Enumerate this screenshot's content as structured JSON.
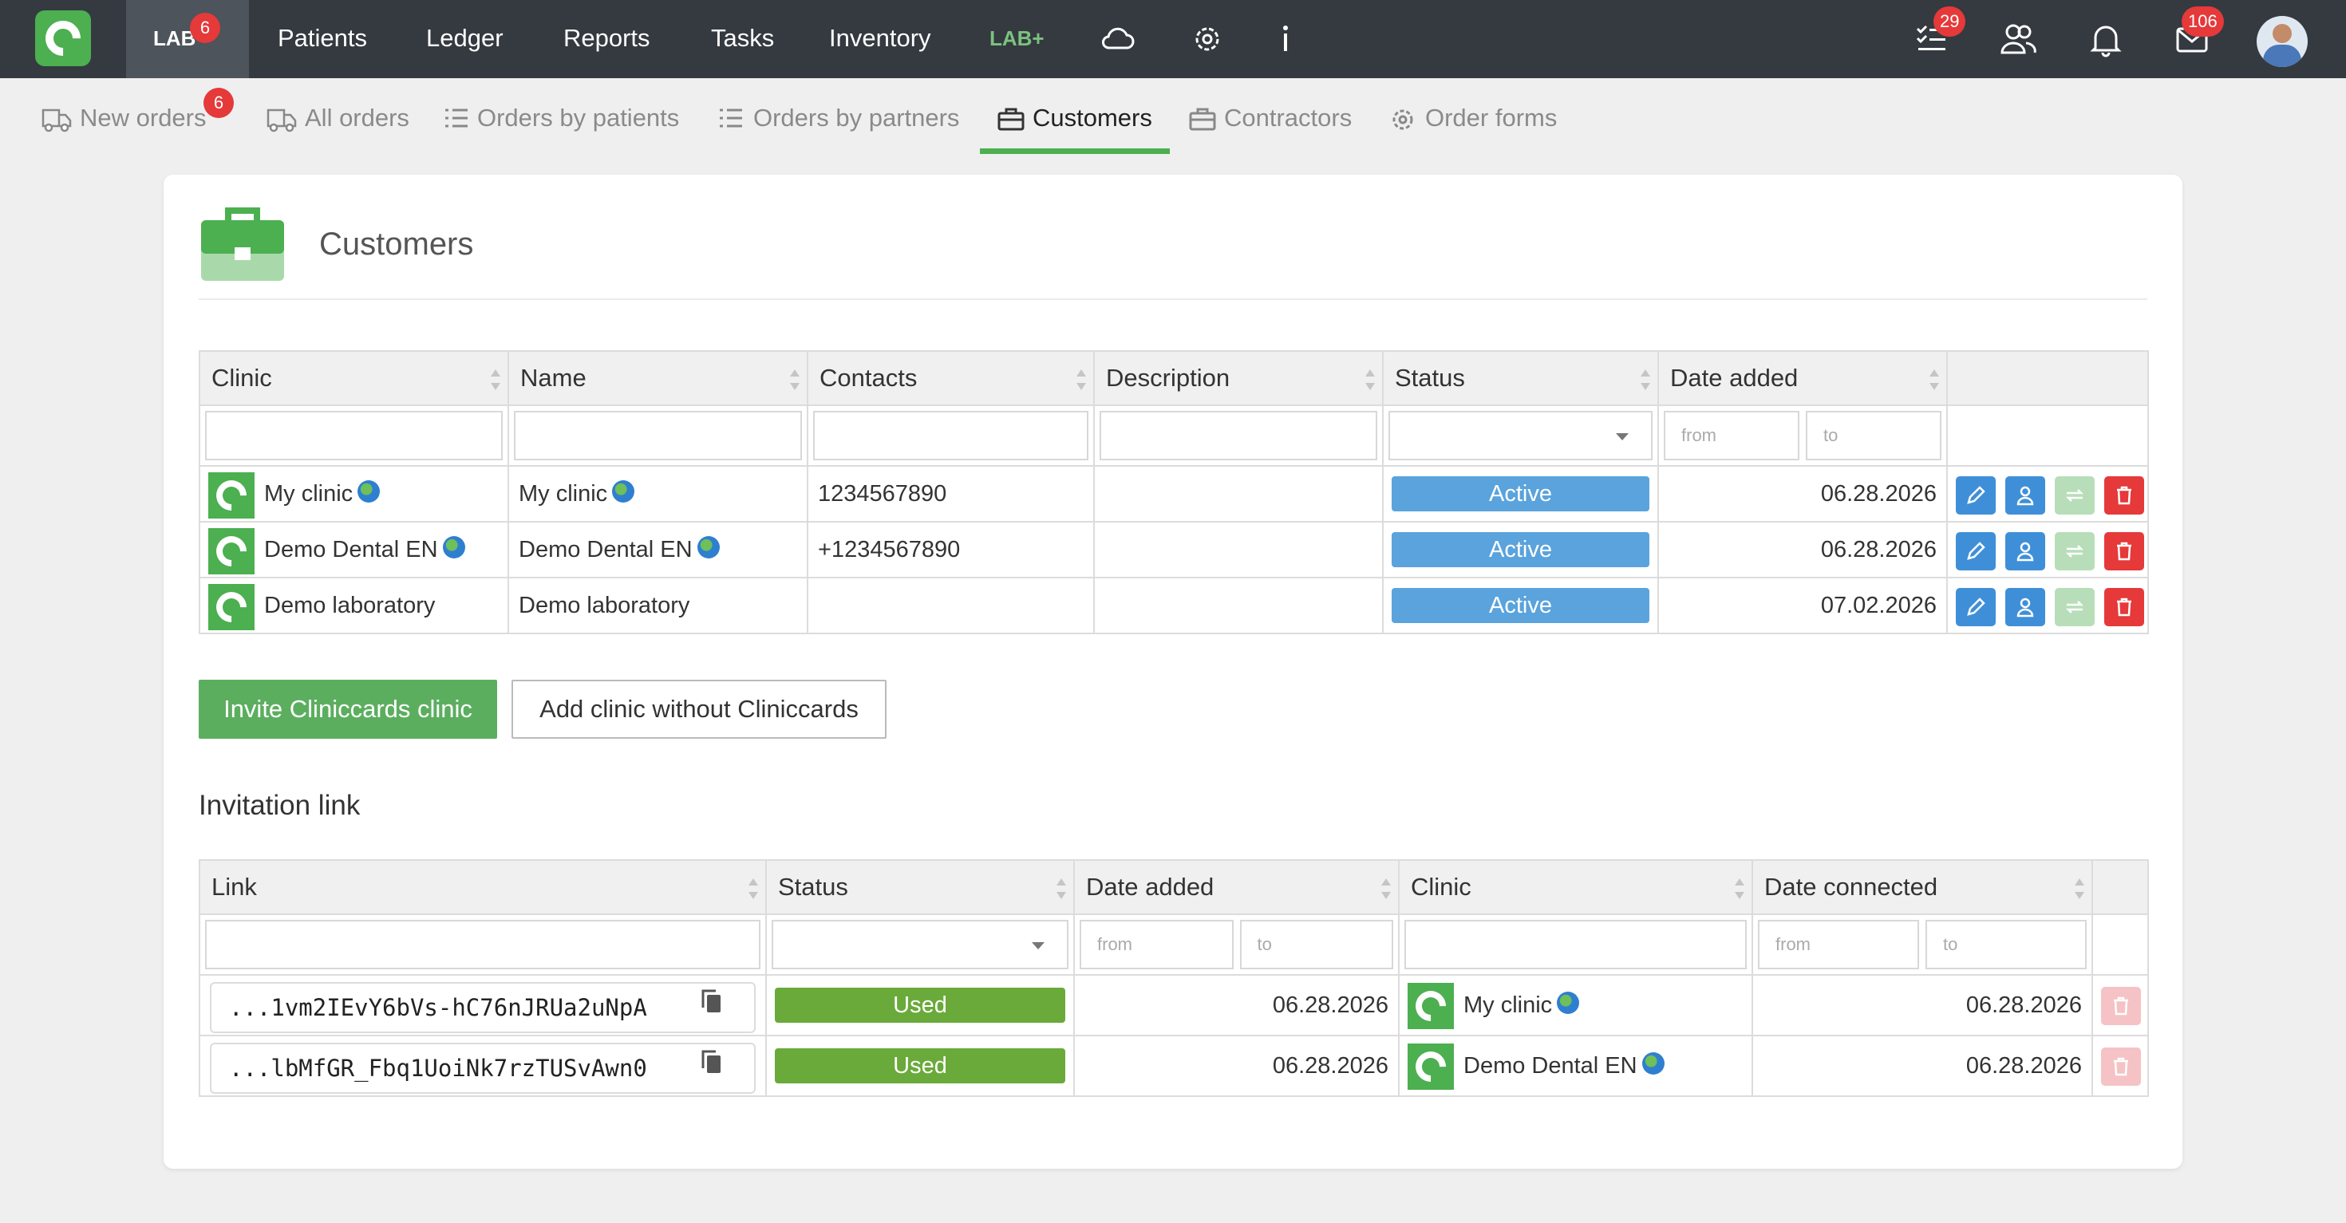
{
  "topnav": {
    "lab_label": "LAB",
    "lab_badge": "6",
    "items": [
      "Patients",
      "Ledger",
      "Reports",
      "Tasks",
      "Inventory"
    ],
    "labplus": "LAB+",
    "tasks_badge": "29",
    "messages_badge": "106"
  },
  "subnav": {
    "tabs": [
      "New orders",
      "All orders",
      "Orders by patients",
      "Orders by partners",
      "Customers",
      "Contractors",
      "Order forms"
    ],
    "new_orders_badge": "6",
    "active": "Customers"
  },
  "page": {
    "title": "Customers"
  },
  "customers_table": {
    "headers": [
      "Clinic",
      "Name",
      "Contacts",
      "Description",
      "Status",
      "Date added"
    ],
    "filter_from": "from",
    "filter_to": "to",
    "rows": [
      {
        "clinic": "My clinic",
        "name": "My clinic",
        "contacts": "1234567890",
        "description": "",
        "status": "Active",
        "date": "06.28.2026"
      },
      {
        "clinic": "Demo Dental EN",
        "name": "Demo Dental EN",
        "contacts": "+1234567890",
        "description": "",
        "status": "Active",
        "date": "06.28.2026"
      },
      {
        "clinic": "Demo laboratory",
        "name": "Demo laboratory",
        "contacts": "",
        "description": "",
        "status": "Active",
        "date": "07.02.2026"
      }
    ]
  },
  "buttons": {
    "invite": "Invite Cliniccards clinic",
    "add": "Add clinic without Cliniccards"
  },
  "invitation": {
    "title": "Invitation link",
    "headers": [
      "Link",
      "Status",
      "Date added",
      "Clinic",
      "Date connected"
    ],
    "rows": [
      {
        "link": "...1vm2IEvY6bVs-hC76nJRUa2uNpA",
        "status": "Used",
        "date_added": "06.28.2026",
        "clinic": "My clinic",
        "date_connected": "06.28.2026"
      },
      {
        "link": "...lbMfGR_Fbq1UoiNk7rzTUSvAwn0",
        "status": "Used",
        "date_added": "06.28.2026",
        "clinic": "Demo Dental EN",
        "date_connected": "06.28.2026"
      }
    ]
  },
  "colors": {
    "navbar": "#343a40",
    "brand_green": "#4caf50",
    "status_active": "#5aa3dc",
    "status_used": "#6aaa3a",
    "danger": "#e5393a"
  },
  "icons": [
    "cloud-icon",
    "gear-icon",
    "info-icon",
    "tasks-icon",
    "users-icon",
    "bell-icon",
    "mail-icon",
    "truck-icon",
    "list-icon",
    "briefcase-icon",
    "pencil-icon",
    "user-icon",
    "sync-icon",
    "trash-icon",
    "copy-icon",
    "globe-icon"
  ]
}
